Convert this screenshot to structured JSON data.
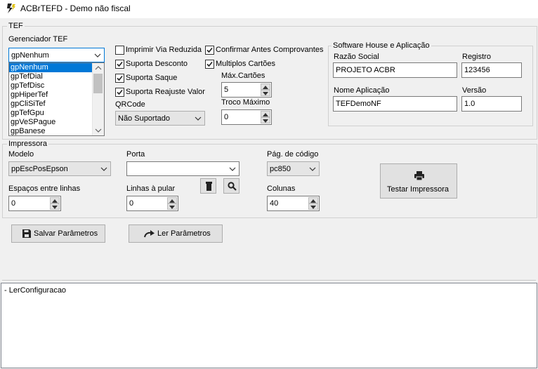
{
  "window": {
    "title": "ACBrTEFD - Demo não fiscal",
    "icon": "lightning-icon"
  },
  "tef": {
    "legend": "TEF",
    "gerenciador_label": "Gerenciador TEF",
    "gerenciador_value": "gpNenhum",
    "gerenciador_options": [
      "gpNenhum",
      "gpTefDial",
      "gpTefDisc",
      "gpHiperTef",
      "gpCliSiTef",
      "gpTefGpu",
      "gpVeSPague",
      "gpBanese"
    ],
    "checks": {
      "imprimir_via_reduzida": {
        "label": "Imprimir Via Reduzida",
        "checked": false
      },
      "suporta_desconto": {
        "label": "Suporta Desconto",
        "checked": true
      },
      "suporta_saque": {
        "label": "Suporta Saque",
        "checked": true
      },
      "suporta_reajuste_valor": {
        "label": "Suporta Reajuste Valor",
        "checked": true
      },
      "confirmar_antes": {
        "label": "Confirmar Antes Comprovantes",
        "checked": true
      },
      "multiplos_cartoes": {
        "label": "Multiplos Cartões",
        "checked": true
      }
    },
    "qrcode_label": "QRCode",
    "qrcode_value": "Não Suportado",
    "max_cartoes_label": "Máx.Cartões",
    "max_cartoes_value": "5",
    "troco_maximo_label": "Troco Máximo",
    "troco_maximo_value": "0"
  },
  "software_house": {
    "legend": "Software House e Aplicação",
    "razao_social_label": "Razão Social",
    "razao_social_value": "PROJETO ACBR",
    "registro_label": "Registro",
    "registro_value": "123456",
    "nome_aplicacao_label": "Nome Aplicação",
    "nome_aplicacao_value": "TEFDemoNF",
    "versao_label": "Versão",
    "versao_value": "1.0"
  },
  "impressora": {
    "legend": "Impressora",
    "modelo_label": "Modelo",
    "modelo_value": "ppEscPosEpson",
    "porta_label": "Porta",
    "porta_value": "",
    "pag_codigo_label": "Pág. de código",
    "pag_codigo_value": "pc850",
    "espacos_label": "Espaços entre linhas",
    "espacos_value": "0",
    "linhas_pular_label": "Linhas à pular",
    "linhas_pular_value": "0",
    "colunas_label": "Colunas",
    "colunas_value": "40",
    "testar_label": "Testar Impressora"
  },
  "actions": {
    "salvar_label": "Salvar Parâmetros",
    "ler_label": "Ler Parâmetros"
  },
  "log": {
    "lines": [
      "- LerConfiguracao"
    ]
  },
  "colors": {
    "accent": "#0078d7",
    "background": "#f0f0f0"
  }
}
